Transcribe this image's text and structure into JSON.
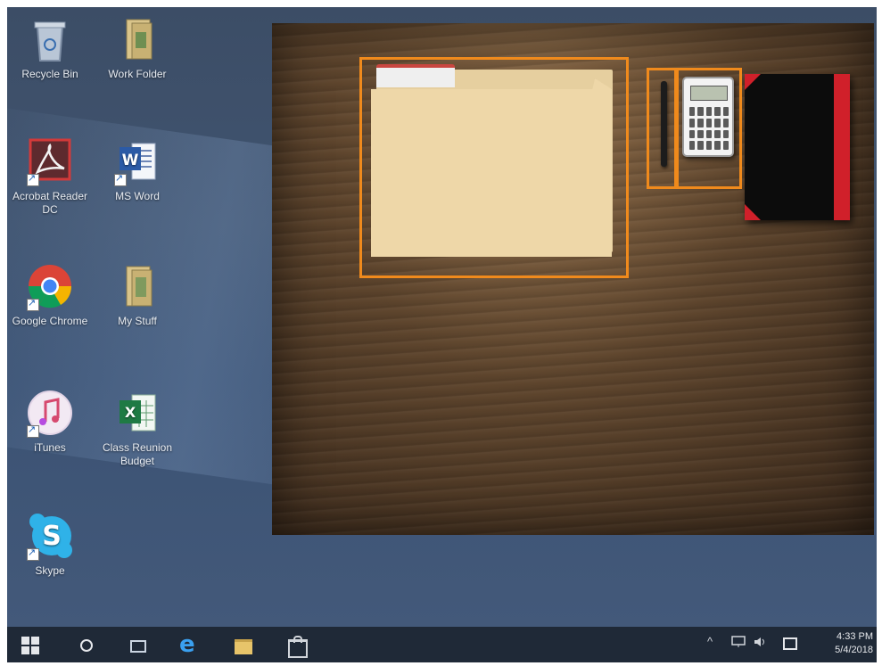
{
  "desktop_icons": [
    {
      "label": "Recycle Bin"
    },
    {
      "label": "Work Folder"
    },
    {
      "label": "Acrobat Reader DC"
    },
    {
      "label": "MS Word"
    },
    {
      "label": "Google Chrome"
    },
    {
      "label": "My Stuff"
    },
    {
      "label": "iTunes"
    },
    {
      "label": "Class Reunion Budget"
    },
    {
      "label": "Skype"
    }
  ],
  "taskbar": {
    "edge_glyph": "e",
    "tray_chevron": "^",
    "clock_time": "4:33 PM",
    "clock_date": "5/4/2018"
  },
  "colors": {
    "highlight": "#f08a1c",
    "taskbar": "#1f2937",
    "desktop": "#405470"
  }
}
